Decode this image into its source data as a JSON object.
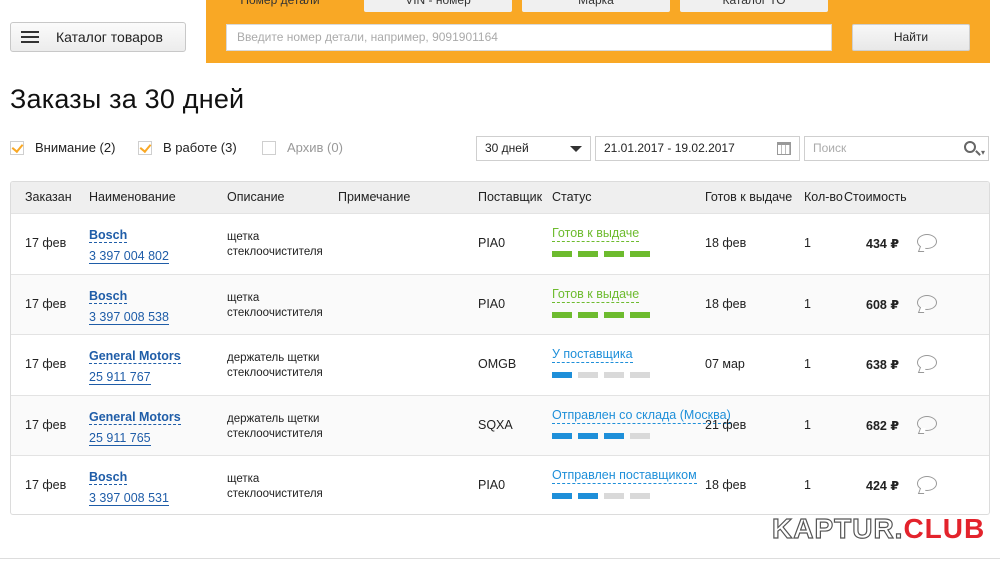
{
  "header": {
    "catalog_button": "Каталог товаров",
    "tabs": [
      {
        "label": "Номер детали",
        "active": true
      },
      {
        "label": "VIN - номер",
        "active": false
      },
      {
        "label": "Марка",
        "active": false
      },
      {
        "label": "Каталог ТО",
        "active": false
      }
    ],
    "search_placeholder": "Введите номер детали, например, 9091901164",
    "find_button": "Найти",
    "accent_color": "#f9a825"
  },
  "page_title": "Заказы за 30 дней",
  "filters": {
    "attention": {
      "label": "Внимание (2)",
      "checked": true
    },
    "in_work": {
      "label": "В работе (3)",
      "checked": true
    },
    "archive": {
      "label": "Архив (0)",
      "checked": false
    },
    "period": "30 дней",
    "date_range": "21.01.2017 - 19.02.2017",
    "search_placeholder": "Поиск"
  },
  "table": {
    "columns": {
      "ordered": "Заказан",
      "name": "Наименование",
      "description": "Описание",
      "note": "Примечание",
      "supplier": "Поставщик",
      "status": "Статус",
      "ready": "Готов к выдаче",
      "qty": "Кол-во",
      "cost": "Стоимость"
    },
    "rows": [
      {
        "ordered": "17 фев",
        "brand": "Bosch",
        "part": "3 397 004 802",
        "desc1": "щетка",
        "desc2": "стеклоочистителя",
        "note": "",
        "supplier": "PIA0",
        "status": "Готов к выдаче",
        "status_color": "#6dbb2e",
        "progress": 4,
        "ready": "18 фев",
        "qty": "1",
        "cost": "434 ₽"
      },
      {
        "ordered": "17 фев",
        "brand": "Bosch",
        "part": "3 397 008 538",
        "desc1": "щетка",
        "desc2": "стеклоочистителя",
        "note": "",
        "supplier": "PIA0",
        "status": "Готов к выдаче",
        "status_color": "#6dbb2e",
        "progress": 4,
        "ready": "18 фев",
        "qty": "1",
        "cost": "608 ₽"
      },
      {
        "ordered": "17 фев",
        "brand": "General Motors",
        "part": "25 911 767",
        "desc1": "держатель щетки",
        "desc2": "стеклоочистителя",
        "note": "",
        "supplier": "OMGB",
        "status": "У поставщика",
        "status_color": "#1e8fd9",
        "progress": 1,
        "ready": "07 мар",
        "qty": "1",
        "cost": "638 ₽"
      },
      {
        "ordered": "17 фев",
        "brand": "General Motors",
        "part": "25 911 765",
        "desc1": "держатель щетки",
        "desc2": "стеклоочистителя",
        "note": "",
        "supplier": "SQXA",
        "status": "Отправлен со склада (Москва)",
        "status_color": "#1e8fd9",
        "progress": 3,
        "ready": "21 фев",
        "qty": "1",
        "cost": "682 ₽"
      },
      {
        "ordered": "17 фев",
        "brand": "Bosch",
        "part": "3 397 008 531",
        "desc1": "щетка",
        "desc2": "стеклоочистителя",
        "note": "",
        "supplier": "PIA0",
        "status": "Отправлен поставщиком",
        "status_color": "#1e8fd9",
        "progress": 2,
        "ready": "18 фев",
        "qty": "1",
        "cost": "424 ₽"
      }
    ]
  },
  "watermark": {
    "part1": "KAPTUR.",
    "part2": "CLUB"
  }
}
